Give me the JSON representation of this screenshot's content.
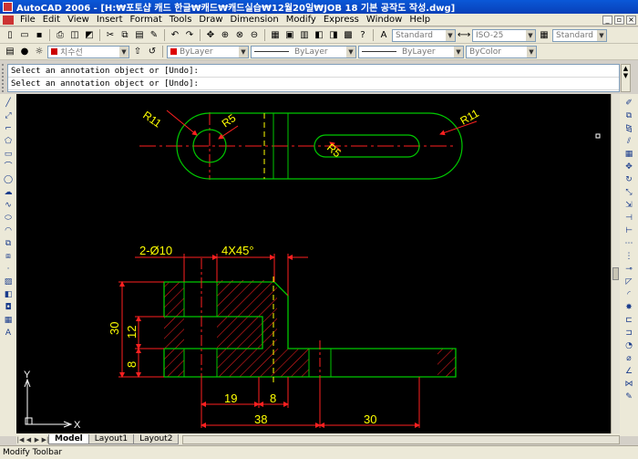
{
  "window": {
    "title": "AutoCAD 2006 - [H:₩포토샵 캐드 한글₩캐드₩캐드실습₩12월20일₩JOB 18 기본 공작도 작성.dwg]"
  },
  "menubar": {
    "items": [
      "File",
      "Edit",
      "View",
      "Insert",
      "Format",
      "Tools",
      "Draw",
      "Dimension",
      "Modify",
      "Express",
      "Window",
      "Help"
    ]
  },
  "toolbar": {
    "text_style": "Standard",
    "dim_style": "ISO-25",
    "table_style": "Standard",
    "layer": "치수선",
    "color": "ByLayer",
    "linetype": "ByLayer",
    "lineweight": "ByLayer",
    "plot_style": "ByColor"
  },
  "command_line": {
    "lines": [
      "Select an annotation object or [Undo]:",
      "Select an annotation object or [Undo]:"
    ]
  },
  "drawing": {
    "top_view_labels": {
      "r11_left": "R11",
      "r5_left": "R5",
      "r5_right": "R5",
      "r11_right": "R11"
    },
    "front_view_labels": {
      "holes": "2-Ø10",
      "chamfer": "4X45°",
      "height": "30",
      "step": "12",
      "base": "8",
      "width_a": "19",
      "width_b": "8",
      "total_left": "38",
      "total_right": "30"
    },
    "ucs": {
      "x": "X",
      "y": "Y"
    }
  },
  "tabs": [
    "Model",
    "Layout1",
    "Layout2"
  ],
  "status": {
    "text": "Modify Toolbar"
  },
  "colors": {
    "object": "#00c800",
    "center": "#ff2020",
    "dimension": "#ff2020",
    "dim_text": "#ffff00",
    "canvas": "#000000"
  }
}
